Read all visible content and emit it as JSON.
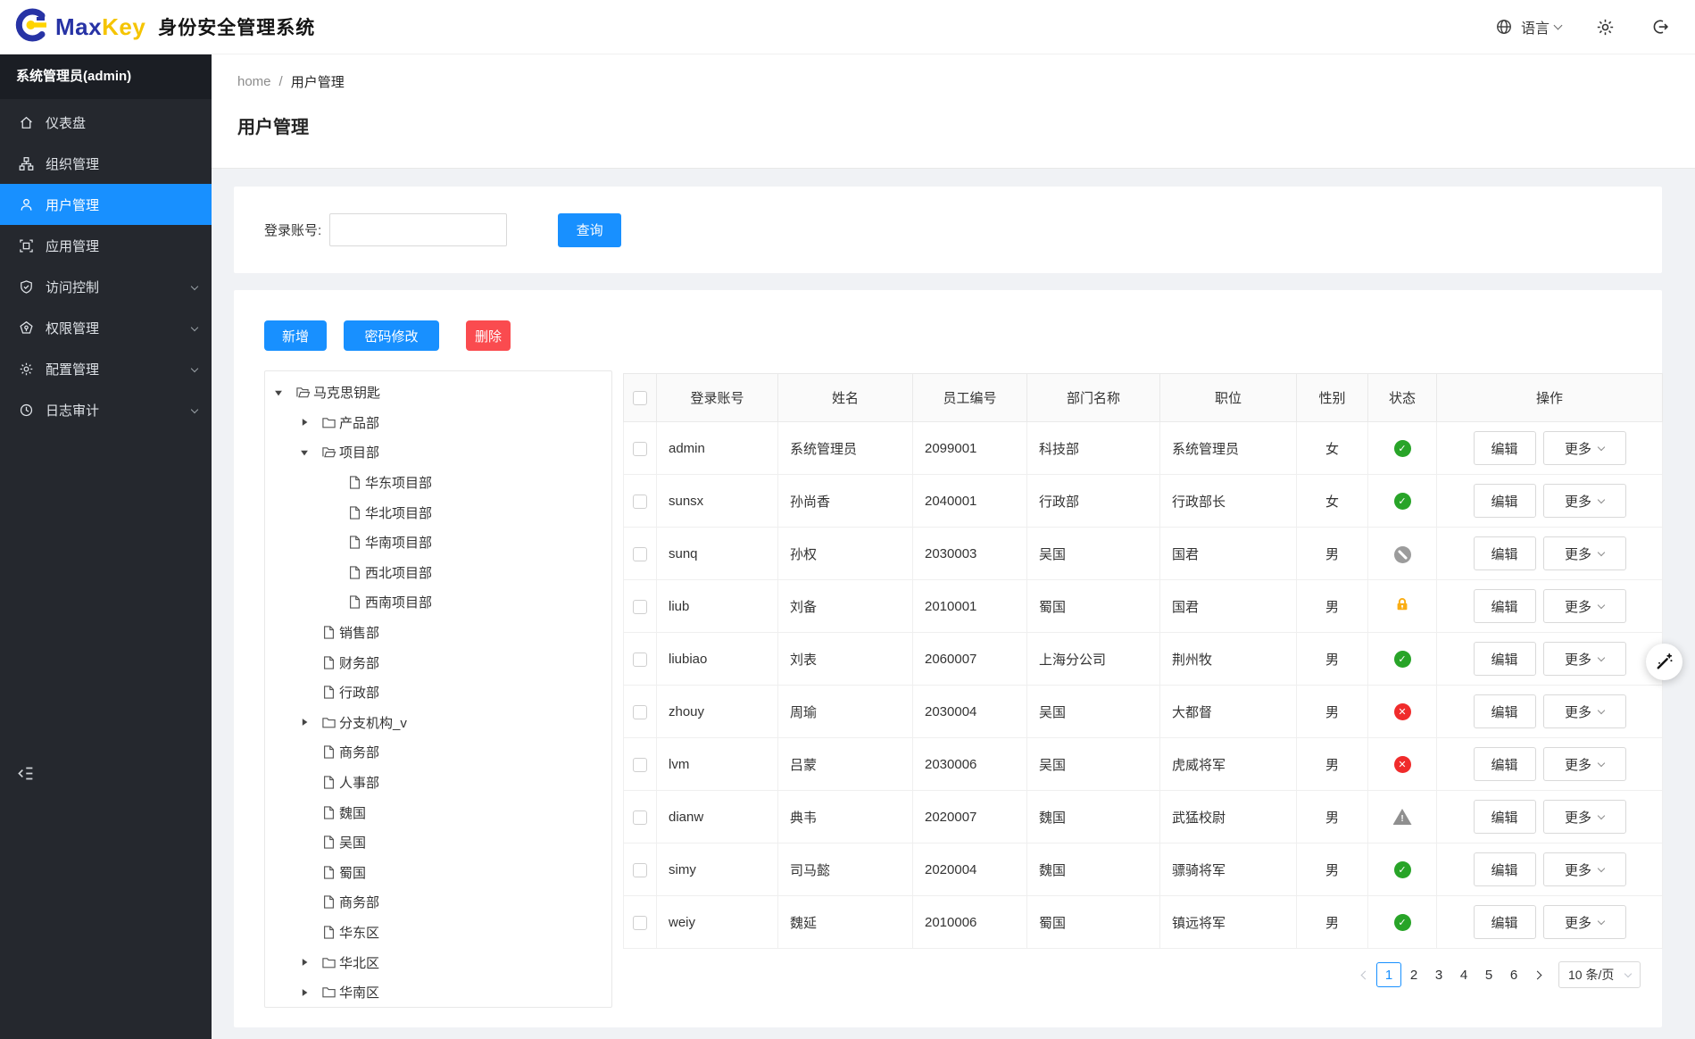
{
  "app": {
    "brand_max": "Max",
    "brand_key": "Key",
    "title": "身份安全管理系统",
    "language_label": "语言"
  },
  "sidebar": {
    "user": "系统管理员(admin)",
    "items": [
      {
        "key": "dashboard",
        "label": "仪表盘",
        "active": false,
        "expandable": false
      },
      {
        "key": "org",
        "label": "组织管理",
        "active": false,
        "expandable": false
      },
      {
        "key": "users",
        "label": "用户管理",
        "active": true,
        "expandable": false
      },
      {
        "key": "apps",
        "label": "应用管理",
        "active": false,
        "expandable": false
      },
      {
        "key": "access",
        "label": "访问控制",
        "active": false,
        "expandable": true
      },
      {
        "key": "permission",
        "label": "权限管理",
        "active": false,
        "expandable": true
      },
      {
        "key": "config",
        "label": "配置管理",
        "active": false,
        "expandable": true
      },
      {
        "key": "audit",
        "label": "日志审计",
        "active": false,
        "expandable": true
      }
    ]
  },
  "breadcrumb": {
    "home": "home",
    "separator": "/",
    "current": "用户管理"
  },
  "page": {
    "title": "用户管理"
  },
  "search": {
    "label": "登录账号:",
    "value": "",
    "button": "查询"
  },
  "toolbar": {
    "add": "新增",
    "change_password": "密码修改",
    "delete": "删除"
  },
  "tree": {
    "items": [
      {
        "label": "马克思钥匙",
        "level": 0,
        "icon": "folder-open",
        "caret": "down"
      },
      {
        "label": "产品部",
        "level": 1,
        "icon": "folder",
        "caret": "right"
      },
      {
        "label": "项目部",
        "level": 1,
        "icon": "folder-open",
        "caret": "down"
      },
      {
        "label": "华东项目部",
        "level": 2,
        "icon": "file",
        "caret": null
      },
      {
        "label": "华北项目部",
        "level": 2,
        "icon": "file",
        "caret": null
      },
      {
        "label": "华南项目部",
        "level": 2,
        "icon": "file",
        "caret": null
      },
      {
        "label": "西北项目部",
        "level": 2,
        "icon": "file",
        "caret": null
      },
      {
        "label": "西南项目部",
        "level": 2,
        "icon": "file",
        "caret": null
      },
      {
        "label": "销售部",
        "level": 1,
        "icon": "file",
        "caret": null
      },
      {
        "label": "财务部",
        "level": 1,
        "icon": "file",
        "caret": null
      },
      {
        "label": "行政部",
        "level": 1,
        "icon": "file",
        "caret": null
      },
      {
        "label": "分支机构_v",
        "level": 1,
        "icon": "folder",
        "caret": "right"
      },
      {
        "label": "商务部",
        "level": 1,
        "icon": "file",
        "caret": null
      },
      {
        "label": "人事部",
        "level": 1,
        "icon": "file",
        "caret": null
      },
      {
        "label": "魏国",
        "level": 1,
        "icon": "file",
        "caret": null
      },
      {
        "label": "吴国",
        "level": 1,
        "icon": "file",
        "caret": null
      },
      {
        "label": "蜀国",
        "level": 1,
        "icon": "file",
        "caret": null
      },
      {
        "label": "商务部",
        "level": 1,
        "icon": "file",
        "caret": null
      },
      {
        "label": "华东区",
        "level": 1,
        "icon": "file",
        "caret": null
      },
      {
        "label": "华北区",
        "level": 1,
        "icon": "folder",
        "caret": "right"
      },
      {
        "label": "华南区",
        "level": 1,
        "icon": "folder",
        "caret": "right"
      }
    ]
  },
  "table": {
    "columns": [
      "登录账号",
      "姓名",
      "员工编号",
      "部门名称",
      "职位",
      "性别",
      "状态",
      "操作"
    ],
    "edit_label": "编辑",
    "more_label": "更多",
    "rows": [
      {
        "account": "admin",
        "name": "系统管理员",
        "employee_id": "2099001",
        "department": "科技部",
        "position": "系统管理员",
        "gender": "女",
        "status": "active"
      },
      {
        "account": "sunsx",
        "name": "孙尚香",
        "employee_id": "2040001",
        "department": "行政部",
        "position": "行政部长",
        "gender": "女",
        "status": "active"
      },
      {
        "account": "sunq",
        "name": "孙权",
        "employee_id": "2030003",
        "department": "吴国",
        "position": "国君",
        "gender": "男",
        "status": "disabled"
      },
      {
        "account": "liub",
        "name": "刘备",
        "employee_id": "2010001",
        "department": "蜀国",
        "position": "国君",
        "gender": "男",
        "status": "locked"
      },
      {
        "account": "liubiao",
        "name": "刘表",
        "employee_id": "2060007",
        "department": "上海分公司",
        "position": "荆州牧",
        "gender": "男",
        "status": "active"
      },
      {
        "account": "zhouy",
        "name": "周瑜",
        "employee_id": "2030004",
        "department": "吴国",
        "position": "大都督",
        "gender": "男",
        "status": "error"
      },
      {
        "account": "lvm",
        "name": "吕蒙",
        "employee_id": "2030006",
        "department": "吴国",
        "position": "虎威将军",
        "gender": "男",
        "status": "error"
      },
      {
        "account": "dianw",
        "name": "典韦",
        "employee_id": "2020007",
        "department": "魏国",
        "position": "武猛校尉",
        "gender": "男",
        "status": "warning"
      },
      {
        "account": "simy",
        "name": "司马懿",
        "employee_id": "2020004",
        "department": "魏国",
        "position": "骠骑将军",
        "gender": "男",
        "status": "active"
      },
      {
        "account": "weiy",
        "name": "魏延",
        "employee_id": "2010006",
        "department": "蜀国",
        "position": "镇远将军",
        "gender": "男",
        "status": "active"
      }
    ]
  },
  "pagination": {
    "pages": [
      "1",
      "2",
      "3",
      "4",
      "5",
      "6"
    ],
    "current": "1",
    "page_size": "10 条/页"
  },
  "colors": {
    "primary": "#1890ff",
    "danger": "#fa4b4f",
    "sidebar_active": "#1890ff",
    "status_active": "#28a428",
    "status_error": "#f02b2b",
    "status_locked": "#faad14",
    "status_disabled": "#9c9c9c",
    "status_warning": "#8f8f8f"
  }
}
